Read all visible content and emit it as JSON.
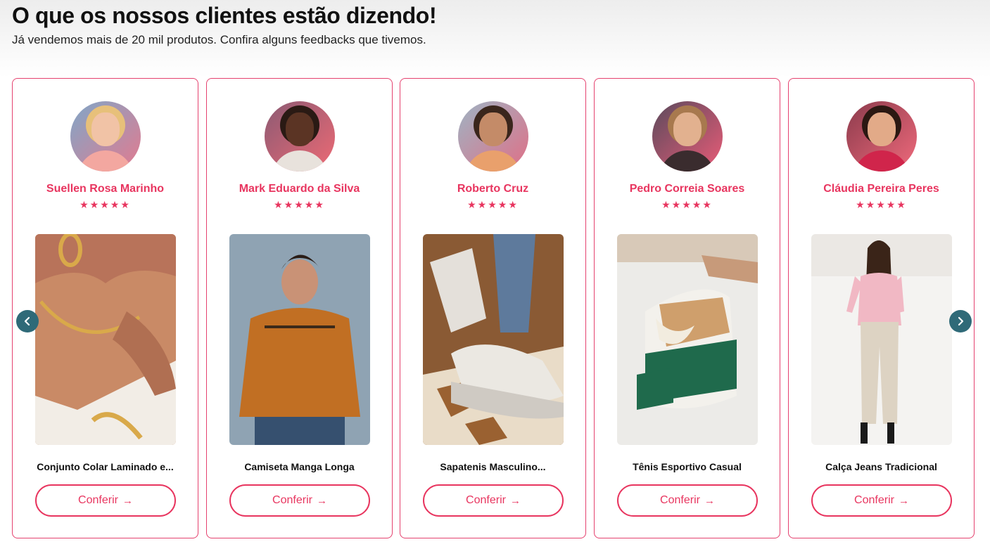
{
  "header": {
    "title": "O que os nossos clientes estão dizendo!",
    "subtitle": "Já vendemos mais de 20 mil produtos. Confira alguns feedbacks que tivemos."
  },
  "carousel": {
    "prev_icon": "chevron-left-icon",
    "next_icon": "chevron-right-icon",
    "nav_color": "#2f6a78"
  },
  "accent_color": "#e8355f",
  "cards": [
    {
      "name": "Suellen Rosa Marinho",
      "stars": "★★★★★",
      "product": "Conjunto Colar Laminado e...",
      "button": "Conferir",
      "arrow": "→"
    },
    {
      "name": "Mark Eduardo da Silva",
      "stars": "★★★★★",
      "product": "Camiseta Manga Longa",
      "button": "Conferir",
      "arrow": "→"
    },
    {
      "name": "Roberto Cruz",
      "stars": "★★★★★",
      "product": "Sapatenis Masculino...",
      "button": "Conferir",
      "arrow": "→"
    },
    {
      "name": "Pedro Correia Soares",
      "stars": "★★★★★",
      "product": "Tênis Esportivo Casual",
      "button": "Conferir",
      "arrow": "→"
    },
    {
      "name": "Cláudia Pereira Peres",
      "stars": "★★★★★",
      "product": "Calça Jeans Tradicional",
      "button": "Conferir",
      "arrow": "→"
    }
  ]
}
